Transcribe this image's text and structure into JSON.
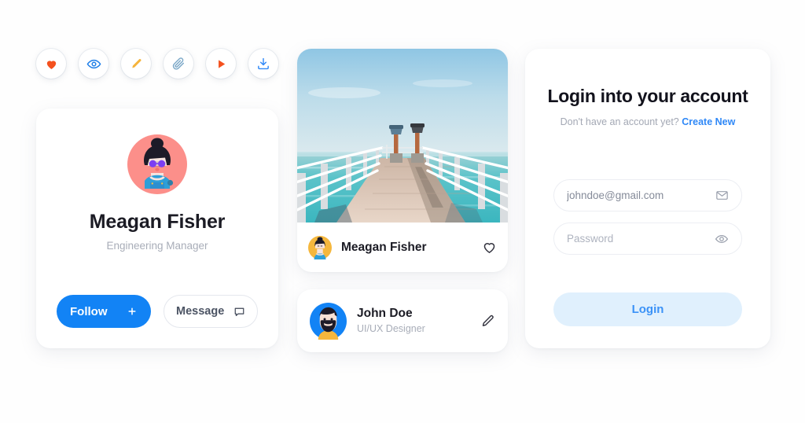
{
  "toolbar": {
    "icons": [
      {
        "name": "heart-icon",
        "label": "Like",
        "color": "#f4511e"
      },
      {
        "name": "eye-icon",
        "label": "View",
        "color": "#1f7fe8"
      },
      {
        "name": "pencil-icon",
        "label": "Edit",
        "color": "#f5b43c"
      },
      {
        "name": "paperclip-icon",
        "label": "Attach",
        "color": "#7aa7c7"
      },
      {
        "name": "play-icon",
        "label": "Play",
        "color": "#f4511e"
      },
      {
        "name": "download-icon",
        "label": "Download",
        "color": "#2f88f7"
      }
    ]
  },
  "profile": {
    "name": "Meagan Fisher",
    "role": "Engineering Manager",
    "follow_label": "Follow",
    "follow_icon": "plus-icon",
    "message_label": "Message",
    "message_icon": "chat-bubble-icon",
    "accent": "#1283f5"
  },
  "post": {
    "author": "Meagan Fisher",
    "like_icon": "heart-outline-icon",
    "image_alt": "Wooden pier over turquoise ocean"
  },
  "person": {
    "name": "John Doe",
    "role": "UI/UX Designer",
    "edit_icon": "pencil-outline-icon"
  },
  "login": {
    "title": "Login into your account",
    "subtitle_text": "Don't have an account yet?",
    "create_link": "Create New",
    "email_value": "johndoe@gmail.com",
    "email_placeholder": "johndoe@gmail.com",
    "email_icon": "envelope-icon",
    "password_value": "",
    "password_placeholder": "Password",
    "password_icon": "eye-icon",
    "submit_label": "Login",
    "link_color": "#2f88f7",
    "button_bg": "#e0f0fd"
  }
}
